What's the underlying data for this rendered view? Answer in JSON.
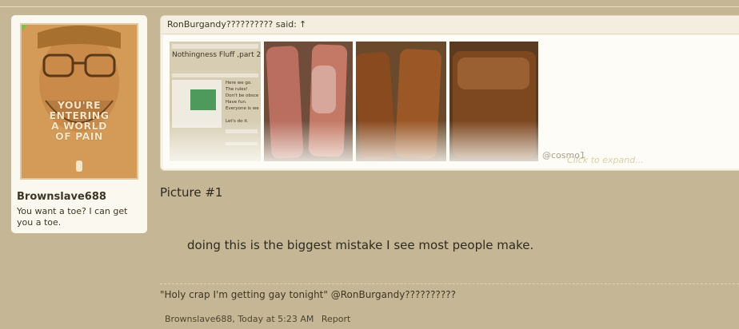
{
  "user": {
    "name": "Brownslave688",
    "title": "You want a toe? I can get you a toe.",
    "avatar_text": "YOU'RE\nENTERING\nA WORLD\nOF PAIN"
  },
  "quote": {
    "author": "RonBurgandy?????????? said:",
    "arrow": "↑",
    "watermark": "@cosmo1",
    "expand": "Click to expand...",
    "thumb_title": "Nothingness Fluff ,part 2",
    "thumb_lines": "Here we go.\nThe rules!\nDon't be obsce\nHave fun.\nEveryone is we\n\nLet's do it."
  },
  "post": {
    "picture_label": "Picture #1",
    "text": "doing this is the biggest mistake I see most people make."
  },
  "signature": "\"Holy crap I'm getting gay tonight\" @RonBurgandy??????????",
  "meta": {
    "byline": "Brownslave688, Today at 5:23 AM",
    "report": "Report"
  },
  "colors": {
    "background": "#c5b796",
    "card": "#fbf8ef",
    "accent": "#7cc242"
  }
}
